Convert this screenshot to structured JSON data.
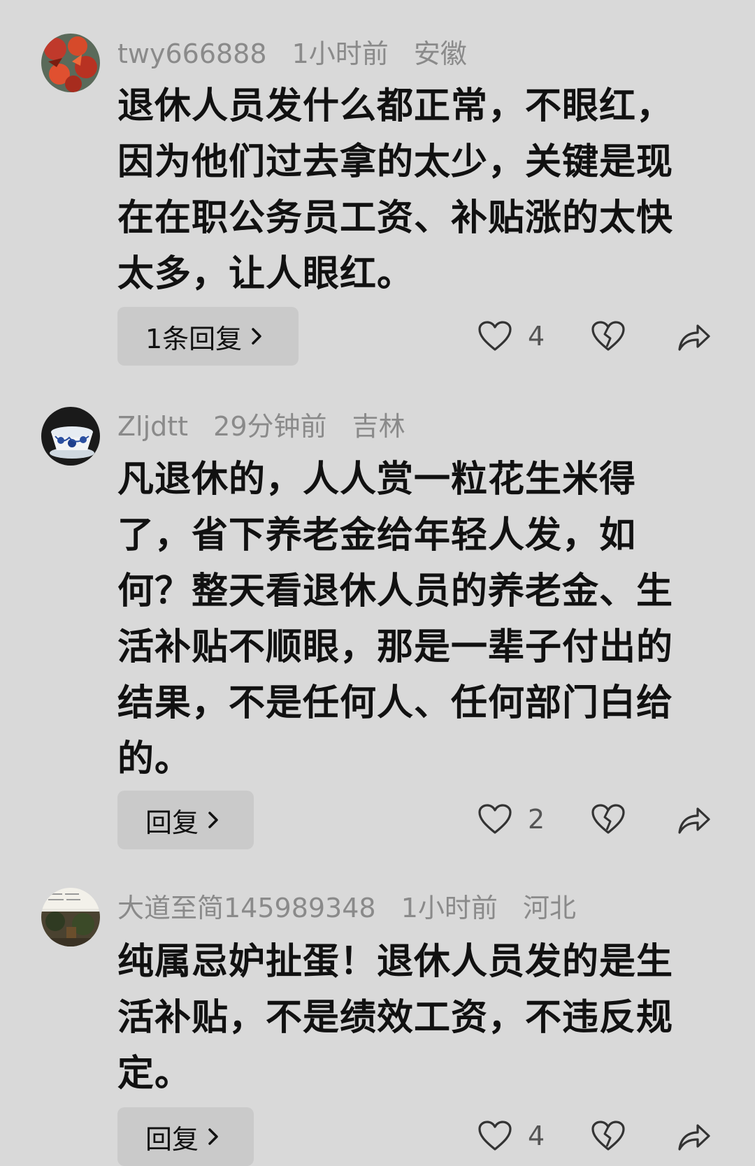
{
  "comments": [
    {
      "username": "twy666888",
      "time": "1小时前",
      "location": "安徽",
      "lines": [
        "退休人员发什么都正常，不眼红，",
        "因为他们过去拿的太少，关键是现",
        "在在职公务员工资、补贴涨的太快",
        "太多，让人眼红。"
      ],
      "reply_label": "1条回复",
      "likes": "4",
      "avatar_icon": "red-maple-leaves-avatar"
    },
    {
      "username": "Zljdtt",
      "time": "29分钟前",
      "location": "吉林",
      "lines": [
        "凡退休的，人人赏一粒花生米得",
        "了，省下养老金给年轻人发，如",
        "何？整天看退休人员的养老金、生",
        "活补贴不顺眼，那是一辈子付出的",
        "结果，不是任何人、任何部门白给",
        "的。"
      ],
      "reply_label": "回复",
      "likes": "2",
      "avatar_icon": "blue-white-porcelain-cup-avatar"
    },
    {
      "username": "大道至简145989348",
      "time": "1小时前",
      "location": "河北",
      "lines": [
        "纯属忌妒扯蛋！退休人员发的是生",
        "活补贴，不是绩效工资，不违反规",
        "定。"
      ],
      "reply_label": "回复",
      "likes": "4",
      "avatar_icon": "landscape-painting-avatar"
    }
  ],
  "colors": {
    "background": "#d9d9d9",
    "meta_text": "#8a8a8a",
    "reply_button_bg": "#cacaca",
    "body_text": "#111111"
  }
}
